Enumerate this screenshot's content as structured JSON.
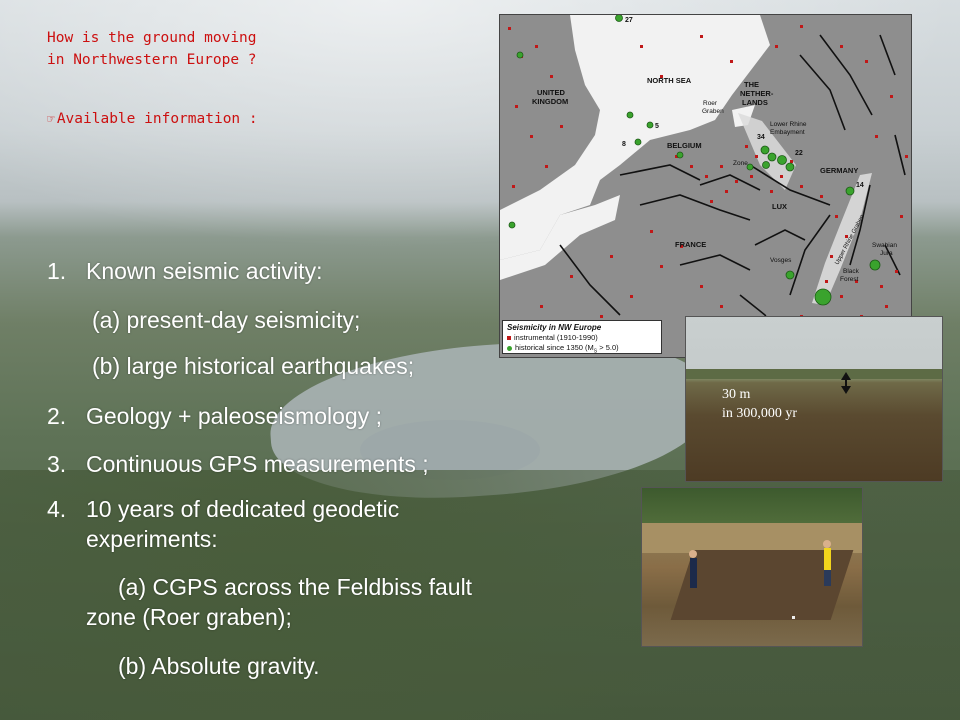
{
  "slide": {
    "title_line1": "How is the ground moving",
    "title_line2": "in Northwestern Europe ?",
    "subtitle_icon": "pointing-hand-icon",
    "subtitle": "Available information :",
    "items": [
      {
        "num": "1.",
        "text": "Known seismic activity:"
      },
      {
        "num": "",
        "text": "(a) present-day seismicity;"
      },
      {
        "num": "",
        "text": "(b) large historical earthquakes;"
      },
      {
        "num": "2.",
        "text": "Geology + paleoseismology ;"
      },
      {
        "num": "3.",
        "text": "Continuous GPS measurements ;"
      },
      {
        "num": "4.",
        "text_line1": "10 years of dedicated geodetic",
        "text_line2": "experiments:"
      },
      {
        "num": "",
        "text_line1": "(a) CGPS across the Feldbiss fault",
        "text_line2": "zone (Roer graben);"
      },
      {
        "num": "",
        "text": "(b) Absolute gravity."
      }
    ]
  },
  "map": {
    "labels": {
      "north_sea": "NORTH SEA",
      "uk_1": "UNITED",
      "uk_2": "KINGDOM",
      "nl_1": "THE",
      "nl_2": "NETHER-",
      "nl_3": "LANDS",
      "roer_1": "Roer",
      "roer_2": "Graben",
      "lre_1": "Lower Rhine",
      "lre_2": "Embayment",
      "belgium": "BELGIUM",
      "germany": "GERMANY",
      "lux": "LUX",
      "france": "FRANCE",
      "vosges": "Vosges",
      "black_1": "Black",
      "black_2": "Forest",
      "swabian_1": "Swabian",
      "swabian_2": "Jura",
      "urg": "Upper Rhine Graben",
      "zone": "Zone",
      "n27": "27",
      "n5": "5",
      "n8": "8",
      "n34": "34",
      "n22": "22",
      "n14": "14"
    },
    "legend": {
      "title": "Seismicity in NW Europe",
      "instrumental": "instrumental (1910-1990)",
      "historical": "historical since 1350 (M",
      "historical_sub": "S",
      "historical_end": " > 5.0)"
    },
    "colors": {
      "sea": "#f2f2f2",
      "land": "#8e8e8e",
      "quake_red": "#c01818",
      "quake_green": "#3aa32d"
    }
  },
  "photo1": {
    "label_line1": "30 m",
    "label_line2": "in 300,000 yr"
  }
}
